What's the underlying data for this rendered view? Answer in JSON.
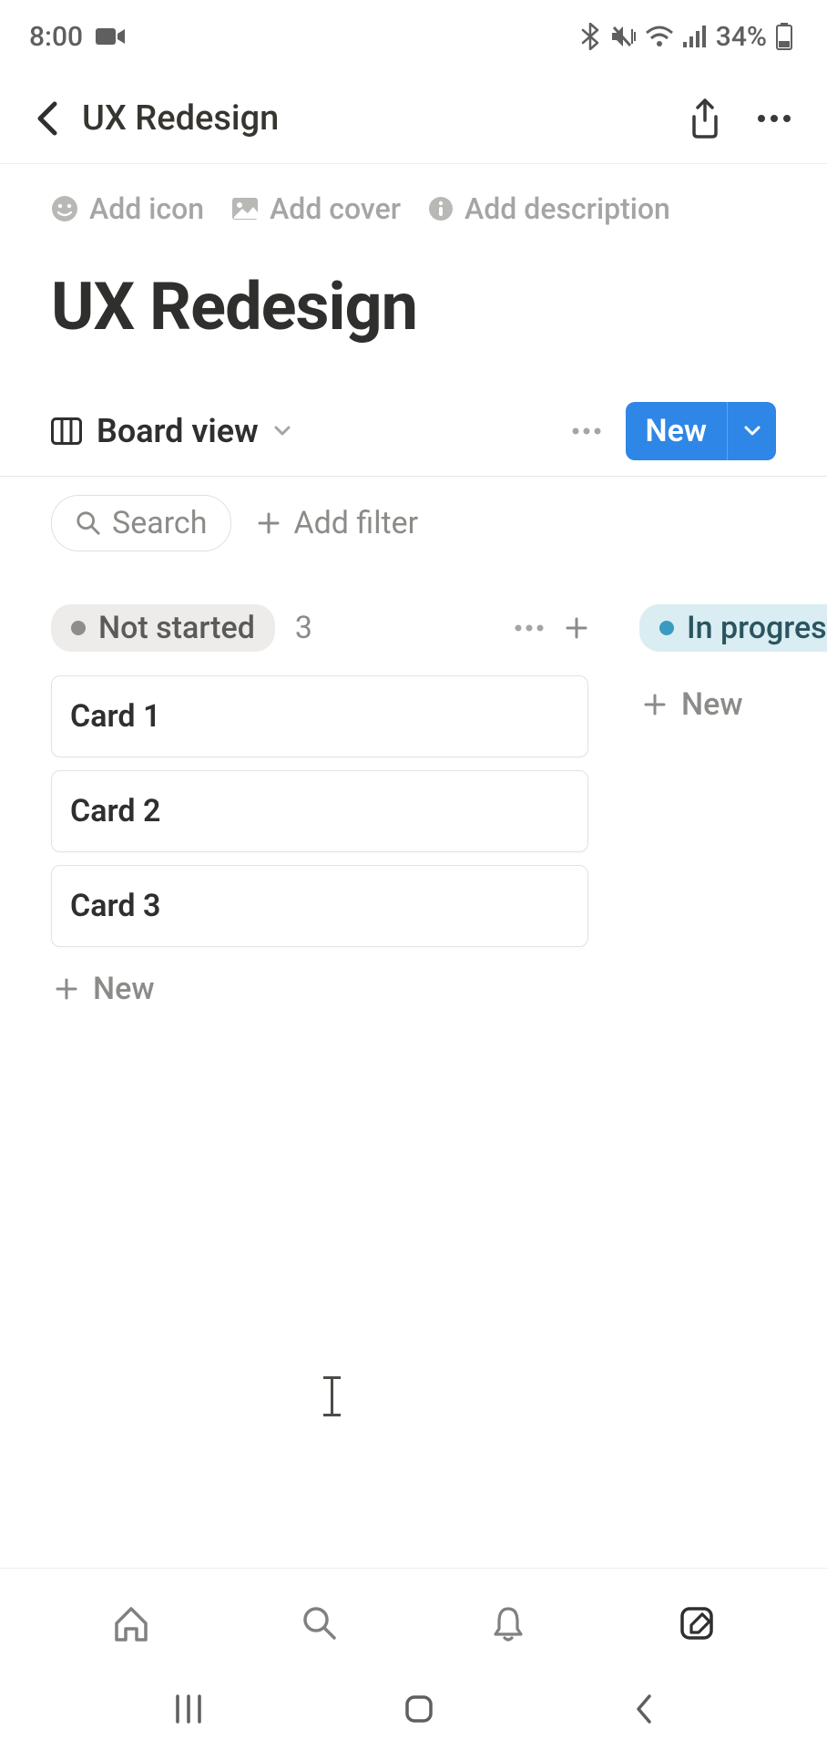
{
  "status_bar": {
    "time": "8:00",
    "battery_text": "34%"
  },
  "top_bar": {
    "title": "UX Redesign"
  },
  "header": {
    "add_icon": "Add icon",
    "add_cover": "Add cover",
    "add_description": "Add description"
  },
  "page_title": "UX Redesign",
  "view": {
    "label": "Board view",
    "new_label": "New"
  },
  "search_filter": {
    "search_label": "Search",
    "add_filter_label": "Add filter"
  },
  "columns": [
    {
      "status": "Not started",
      "count": "3",
      "cards": [
        "Card 1",
        "Card 2",
        "Card 3"
      ],
      "new_label": "New"
    },
    {
      "status": "In progress",
      "count": "",
      "cards": [],
      "new_label": "New"
    }
  ]
}
